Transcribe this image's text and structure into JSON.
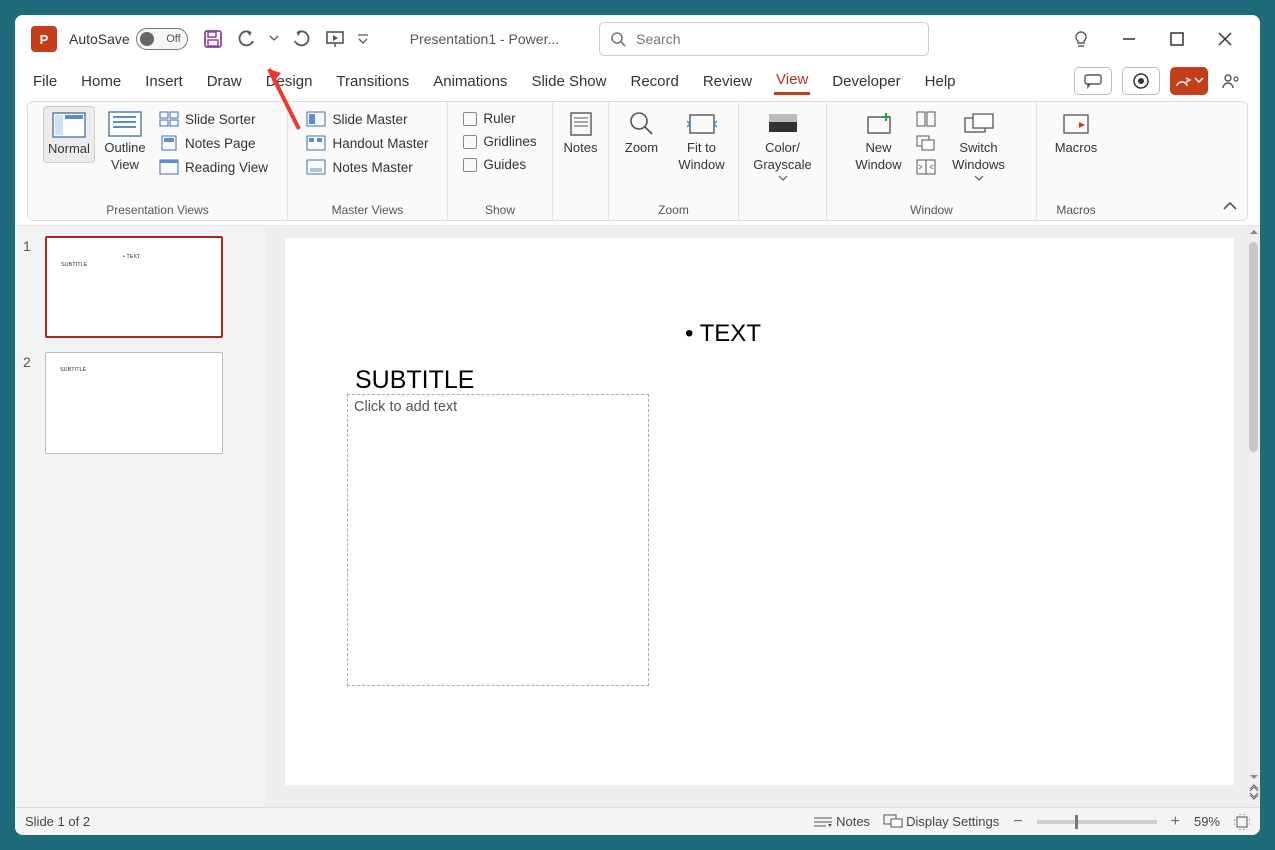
{
  "titlebar": {
    "autosave_label": "AutoSave",
    "autosave_state": "Off",
    "document_title": "Presentation1  -  Power...",
    "search_placeholder": "Search"
  },
  "tabs": [
    "File",
    "Home",
    "Insert",
    "Draw",
    "Design",
    "Transitions",
    "Animations",
    "Slide Show",
    "Record",
    "Review",
    "View",
    "Developer",
    "Help"
  ],
  "active_tab": "View",
  "ribbon": {
    "presentation_views": {
      "label": "Presentation Views",
      "normal": "Normal",
      "outline": "Outline View",
      "slide_sorter": "Slide Sorter",
      "notes_page": "Notes Page",
      "reading_view": "Reading View"
    },
    "master_views": {
      "label": "Master Views",
      "slide_master": "Slide Master",
      "handout_master": "Handout Master",
      "notes_master": "Notes Master"
    },
    "show": {
      "label": "Show",
      "ruler": "Ruler",
      "gridlines": "Gridlines",
      "guides": "Guides"
    },
    "notes": "Notes",
    "zoom_group": {
      "label": "Zoom",
      "zoom": "Zoom",
      "fit": "Fit to Window"
    },
    "color": {
      "label": "Color/ Grayscale"
    },
    "window": {
      "label": "Window",
      "new_window": "New Window",
      "switch": "Switch Windows"
    },
    "macros": {
      "label": "Macros",
      "btn": "Macros"
    }
  },
  "thumbnails": [
    {
      "num": "1",
      "subtitle": "SUBTITLE",
      "bullet": "• TEXT",
      "active": true
    },
    {
      "num": "2",
      "subtitle": "SUBTITLE",
      "bullet": "",
      "active": false
    }
  ],
  "slide": {
    "bullet": "• TEXT",
    "subtitle": "SUBTITLE",
    "placeholder": "Click to add text"
  },
  "statusbar": {
    "slide_info": "Slide 1 of 2",
    "notes": "Notes",
    "display": "Display Settings",
    "zoom": "59%"
  }
}
